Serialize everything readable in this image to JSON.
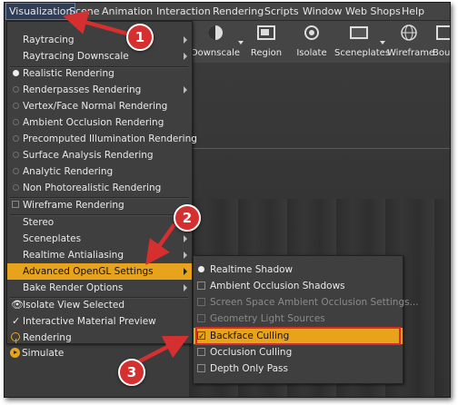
{
  "menubar": {
    "items": [
      "Visualization",
      "Scene",
      "Animation",
      "Interaction",
      "Rendering",
      "Scripts",
      "Window",
      "Web Shops",
      "Help"
    ]
  },
  "toolbar": {
    "buttons": [
      "Downscale",
      "Region",
      "Isolate",
      "Sceneplates",
      "Wireframe",
      "Bou"
    ]
  },
  "visualization_menu": {
    "items": [
      "Raytracing",
      "Raytracing Downscale",
      "Realistic Rendering",
      "Renderpasses Rendering",
      "Vertex/Face Normal Rendering",
      "Ambient Occlusion Rendering",
      "Precomputed Illumination Rendering",
      "Surface Analysis Rendering",
      "Analytic Rendering",
      "Non Photorealistic Rendering",
      "Wireframe Rendering",
      "Stereo",
      "Sceneplates",
      "Realtime Antialiasing",
      "Advanced OpenGL Settings",
      "Bake Render Options",
      "Isolate View Selected",
      "Interactive Material Preview",
      "Rendering",
      "Simulate"
    ]
  },
  "opengl_submenu": {
    "items": [
      "Realtime Shadow",
      "Ambient Occlusion Shadows",
      "Screen Space Ambient Occlusion Settings...",
      "Geometry Light Sources",
      "Backface Culling",
      "Occlusion Culling",
      "Depth Only Pass"
    ]
  },
  "annotations": {
    "steps": [
      "1",
      "2",
      "3"
    ],
    "arrow_color": "#d62f2f",
    "highlight_color": "#e8a31c"
  }
}
